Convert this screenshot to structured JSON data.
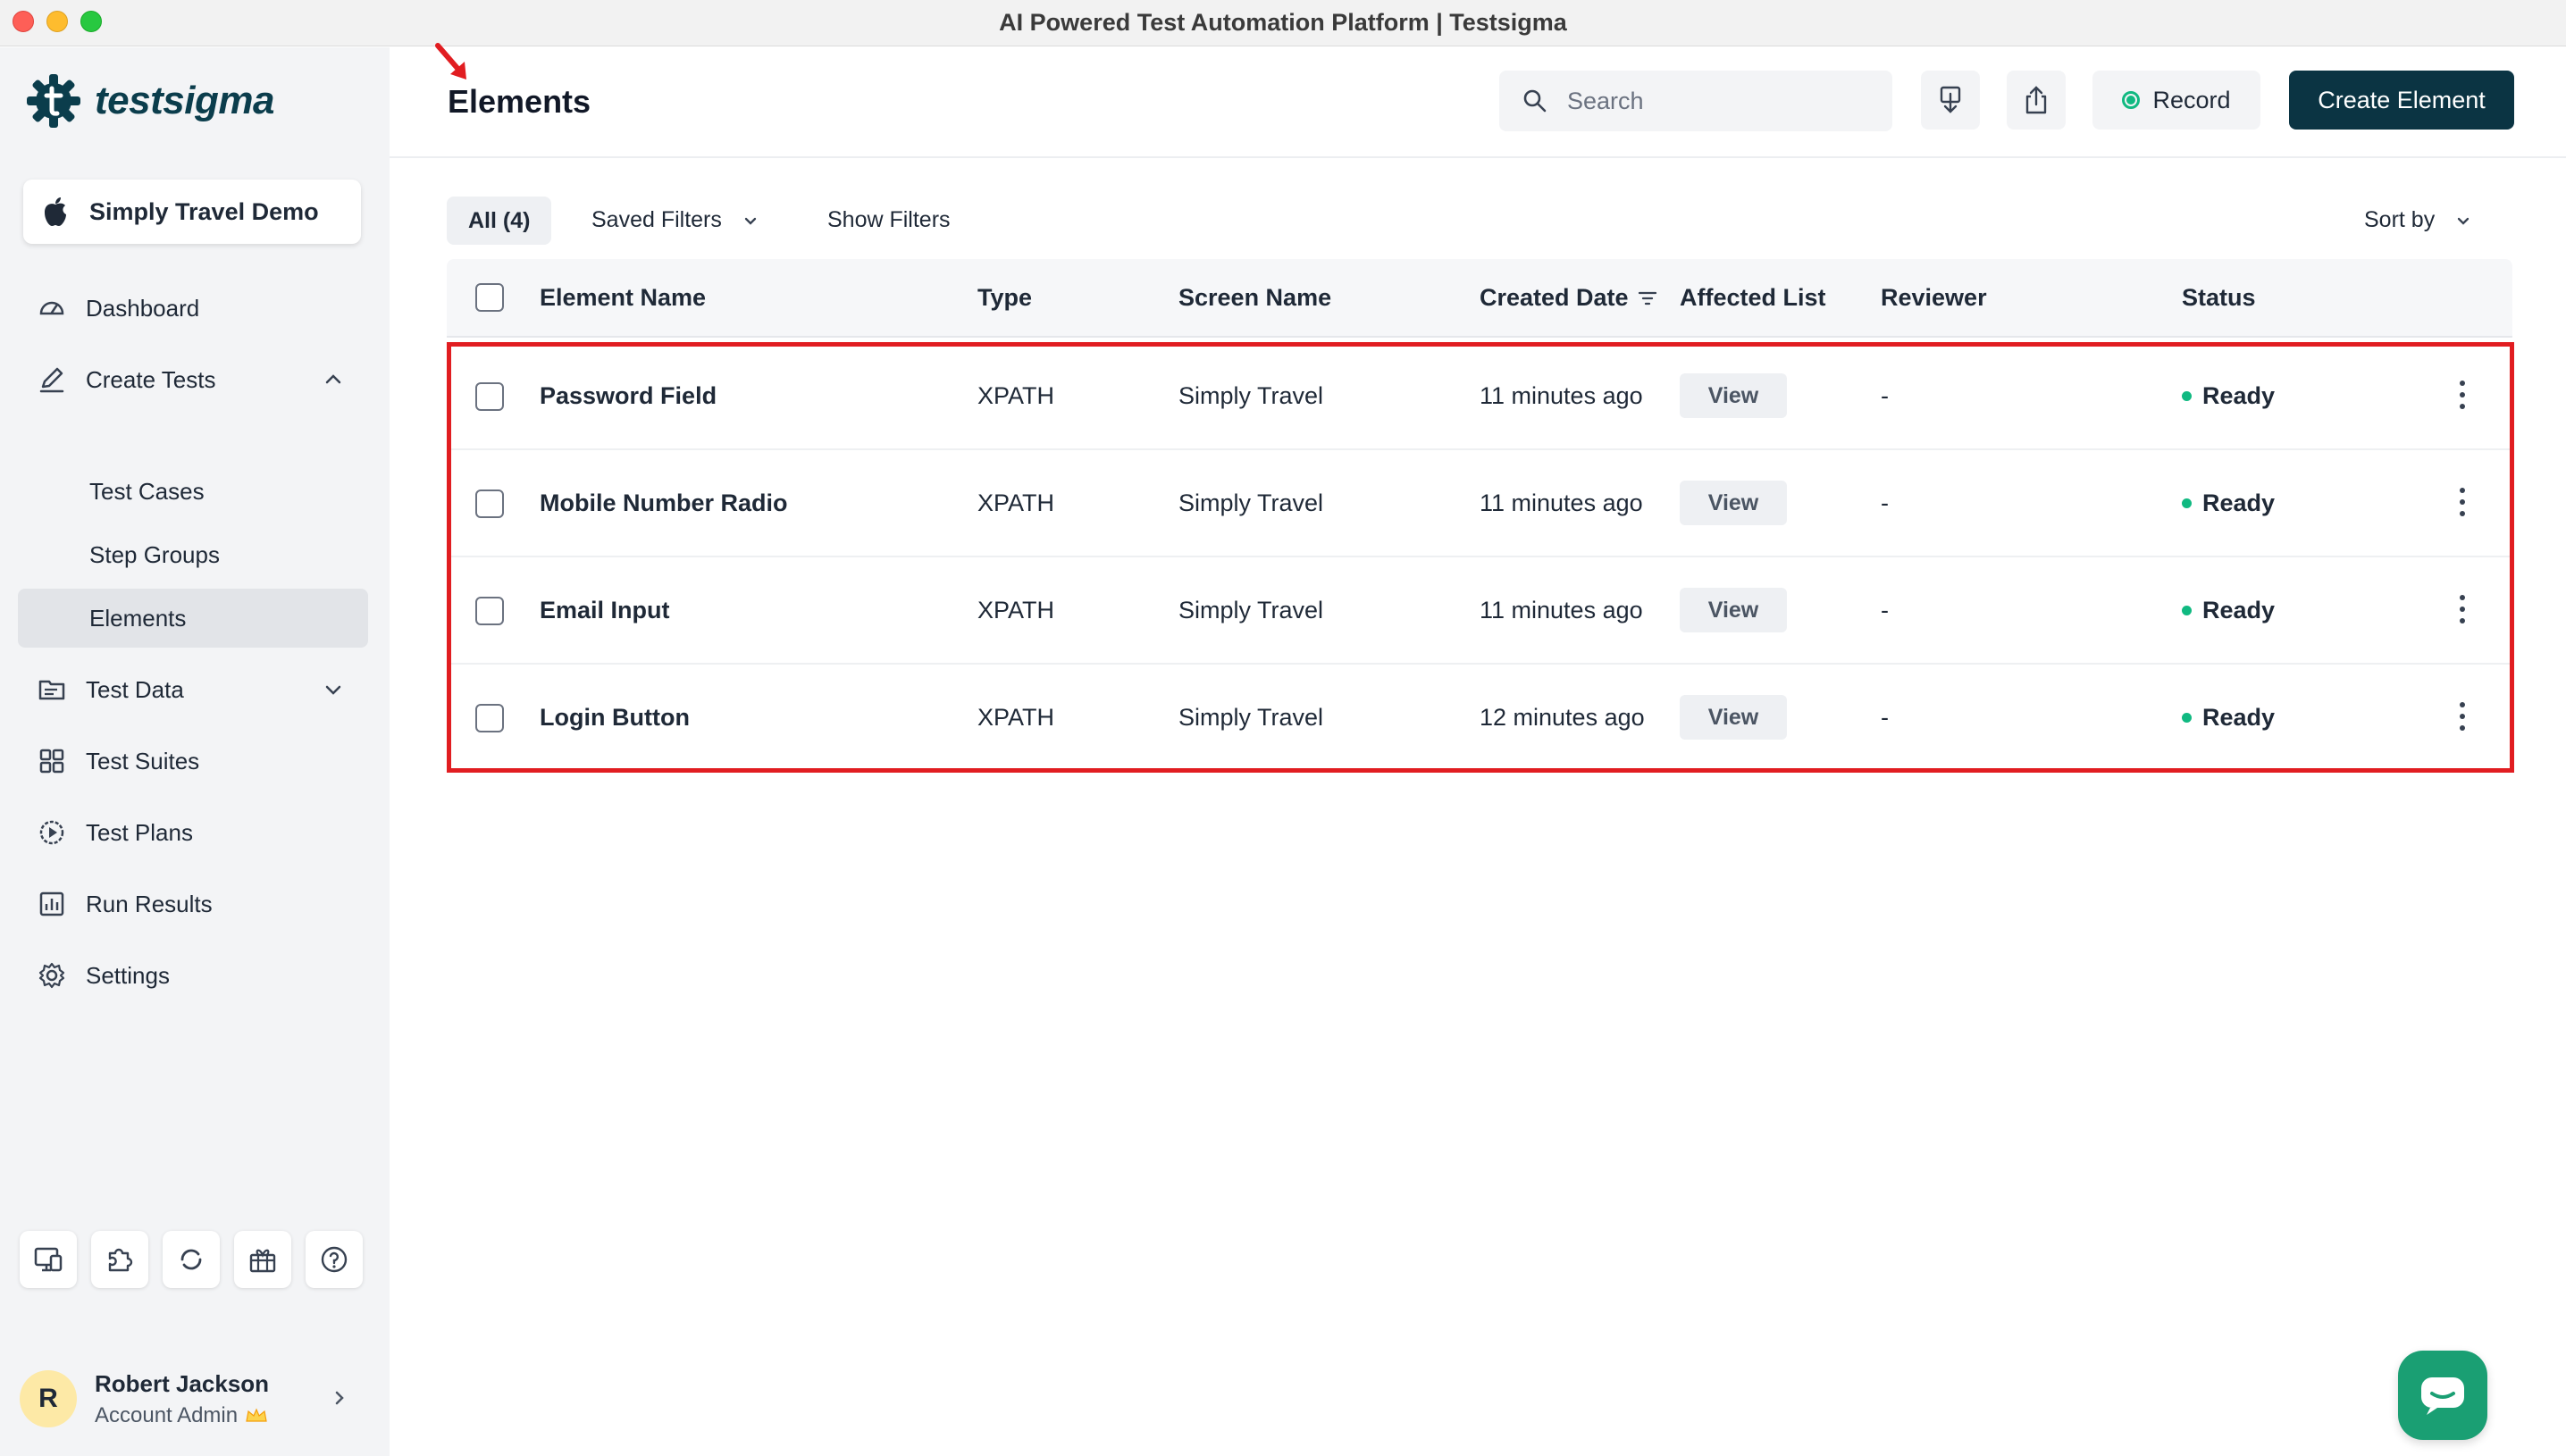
{
  "window": {
    "title": "AI Powered Test Automation Platform | Testsigma"
  },
  "brand": {
    "name": "testsigma",
    "color": "#0b3d4c",
    "accent": "#10b981"
  },
  "project": {
    "name": "Simply Travel Demo",
    "icon": "apple-icon"
  },
  "sidebar": {
    "items": [
      {
        "label": "Dashboard",
        "icon": "dashboard-icon"
      },
      {
        "label": "Create Tests",
        "icon": "pencil-icon",
        "expanded": true
      },
      {
        "label": "Test Cases",
        "sub": true
      },
      {
        "label": "Step Groups",
        "sub": true
      },
      {
        "label": "Elements",
        "sub": true,
        "active": true
      },
      {
        "label": "Test Data",
        "icon": "folder-icon",
        "expanded": false
      },
      {
        "label": "Test Suites",
        "icon": "grid-icon"
      },
      {
        "label": "Test Plans",
        "icon": "play-circle-icon"
      },
      {
        "label": "Run Results",
        "icon": "bar-chart-icon"
      },
      {
        "label": "Settings",
        "icon": "gear-icon"
      }
    ],
    "tools": [
      "monitor-icon",
      "puzzle-icon",
      "refresh-icon",
      "gift-icon",
      "help-icon"
    ]
  },
  "user": {
    "initial": "R",
    "name": "Robert Jackson",
    "role": "Account Admin"
  },
  "header": {
    "title": "Elements",
    "search_placeholder": "Search",
    "record_label": "Record",
    "create_label": "Create Element"
  },
  "filters": {
    "all_label": "All (4)",
    "saved_filters": "Saved Filters",
    "show_filters": "Show Filters",
    "sort_by": "Sort by"
  },
  "table": {
    "columns": [
      "Element Name",
      "Type",
      "Screen Name",
      "Created Date",
      "Affected List",
      "Reviewer",
      "Status"
    ],
    "view_label": "View",
    "rows": [
      {
        "name": "Password Field",
        "type": "XPATH",
        "screen": "Simply Travel",
        "created": "11 minutes ago",
        "reviewer": "-",
        "status": "Ready"
      },
      {
        "name": "Mobile Number Radio",
        "type": "XPATH",
        "screen": "Simply Travel",
        "created": "11 minutes ago",
        "reviewer": "-",
        "status": "Ready"
      },
      {
        "name": "Email Input",
        "type": "XPATH",
        "screen": "Simply Travel",
        "created": "11 minutes ago",
        "reviewer": "-",
        "status": "Ready"
      },
      {
        "name": "Login Button",
        "type": "XPATH",
        "screen": "Simply Travel",
        "created": "12 minutes ago",
        "reviewer": "-",
        "status": "Ready"
      }
    ]
  }
}
